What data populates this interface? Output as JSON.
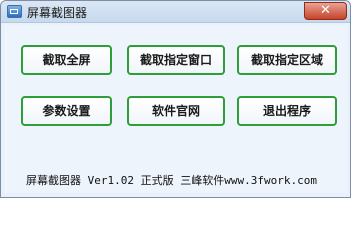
{
  "window": {
    "title": "屏幕截图器",
    "close_label": "✕"
  },
  "buttons": {
    "capture_fullscreen": "截取全屏",
    "capture_window": "截取指定窗口",
    "capture_region": "截取指定区域",
    "settings": "参数设置",
    "website": "软件官网",
    "exit": "退出程序"
  },
  "status": {
    "text": "屏幕截图器 Ver1.02 正式版 三峰软件www.3fwork.com"
  },
  "colors": {
    "button_border": "#2e9e3a",
    "window_bg": "#eef4fb",
    "close_button": "#c7432a"
  },
  "icons": {
    "app": "screenshot-app-icon",
    "close": "close-icon"
  }
}
